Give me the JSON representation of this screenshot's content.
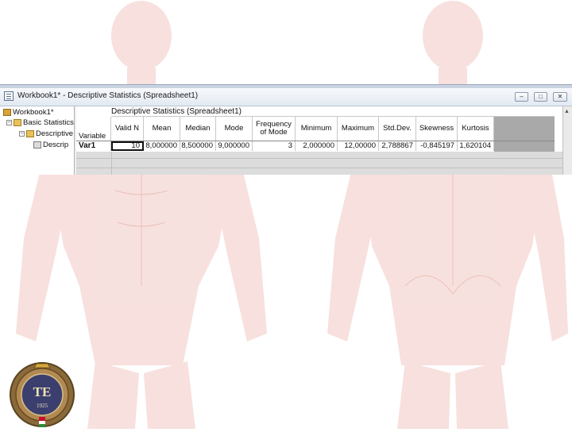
{
  "window": {
    "title": "Workbook1* - Descriptive Statistics (Spreadsheet1)",
    "minimize_glyph": "‒",
    "maximize_glyph": "□",
    "close_glyph": "✕"
  },
  "tree": {
    "root": "Workbook1*",
    "level1": "Basic Statistics",
    "level2": "Descriptive",
    "level3": "Descrip"
  },
  "sheet": {
    "title": "Descriptive Statistics (Spreadsheet1)",
    "variable_header": "Variable",
    "columns": [
      "Valid N",
      "Mean",
      "Median",
      "Mode",
      "Frequency\nof Mode",
      "Minimum",
      "Maximum",
      "Std.Dev.",
      "Skewness",
      "Kurtosis"
    ],
    "rows": [
      {
        "label": "Var1",
        "values": [
          "10",
          "8,000000",
          "8,500000",
          "9,000000",
          "3",
          "2,000000",
          "12,00000",
          "2,788867",
          "-0,845197",
          "1,620104"
        ]
      }
    ]
  },
  "emblem": {
    "letters": "TE",
    "year": "1925"
  },
  "colors": {
    "accent": "#1a1a1a",
    "grid_grey": "#a9a9a9",
    "emblem_brown": "#6b4a1f",
    "flag_red": "#c8102e",
    "flag_green": "#2e8b3a"
  }
}
